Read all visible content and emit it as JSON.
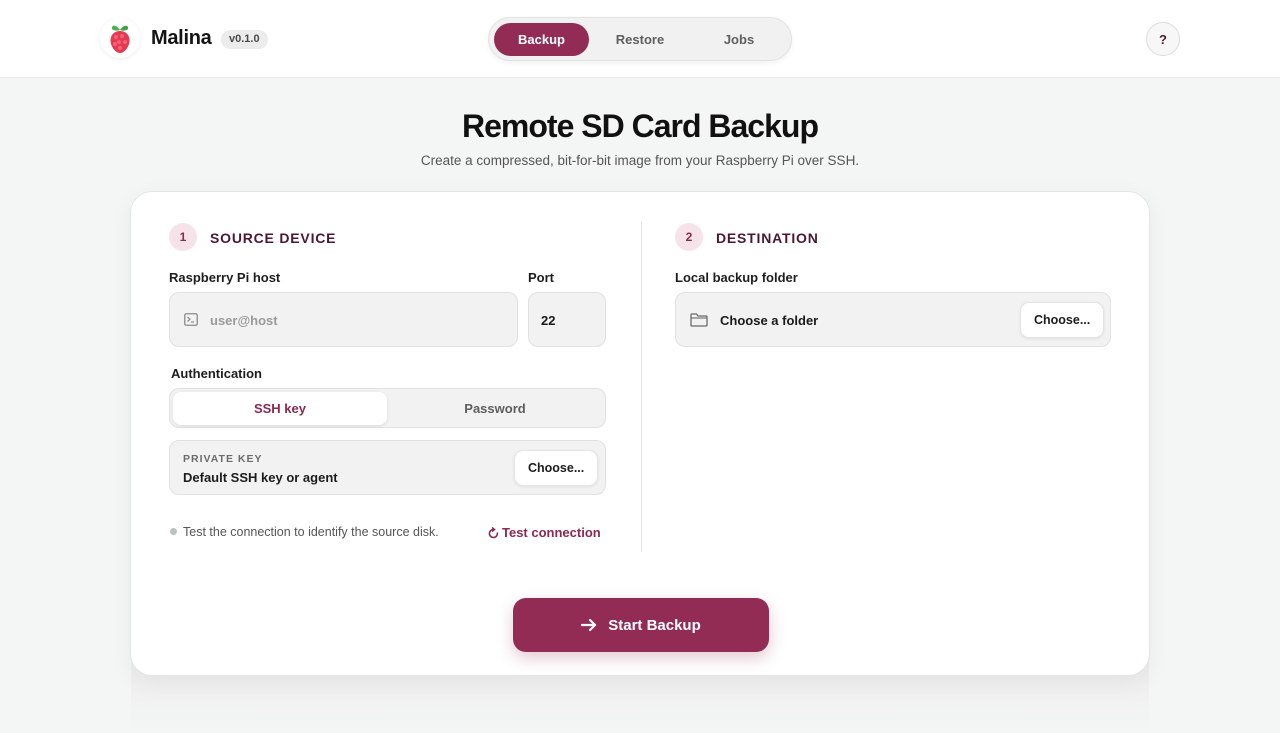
{
  "app": {
    "name": "Malina",
    "version": "v0.1.0"
  },
  "nav": {
    "tabs": [
      {
        "label": "Backup",
        "active": true
      },
      {
        "label": "Restore",
        "active": false
      },
      {
        "label": "Jobs",
        "active": false
      }
    ],
    "help_label": "?"
  },
  "page": {
    "title": "Remote SD Card Backup",
    "subtitle": "Create a compressed, bit-for-bit image from your Raspberry Pi over SSH."
  },
  "source": {
    "step": "1",
    "title": "SOURCE DEVICE",
    "host_label": "Raspberry Pi host",
    "host_placeholder": "user@host",
    "port_label": "Port",
    "port_value": "22",
    "auth_label": "Authentication",
    "auth_options": [
      "SSH key",
      "Password"
    ],
    "auth_selected": "SSH key",
    "private_key_label": "PRIVATE KEY",
    "private_key_value": "Default SSH key or agent",
    "choose_label": "Choose...",
    "status_text": "Test the connection to identify the source disk.",
    "test_label": "Test connection"
  },
  "destination": {
    "step": "2",
    "title": "DESTINATION",
    "folder_label": "Local backup folder",
    "folder_value": "Choose a folder",
    "choose_label": "Choose..."
  },
  "actions": {
    "start_label": "Start Backup"
  },
  "colors": {
    "accent": "#922c55",
    "background": "#f4f6f5",
    "step_badge_bg": "#f6e3ea"
  },
  "icons": {
    "logo": "raspberry-icon",
    "host": "terminal-icon",
    "folder": "folder-icon",
    "test": "refresh-icon",
    "start": "arrow-right-icon"
  }
}
